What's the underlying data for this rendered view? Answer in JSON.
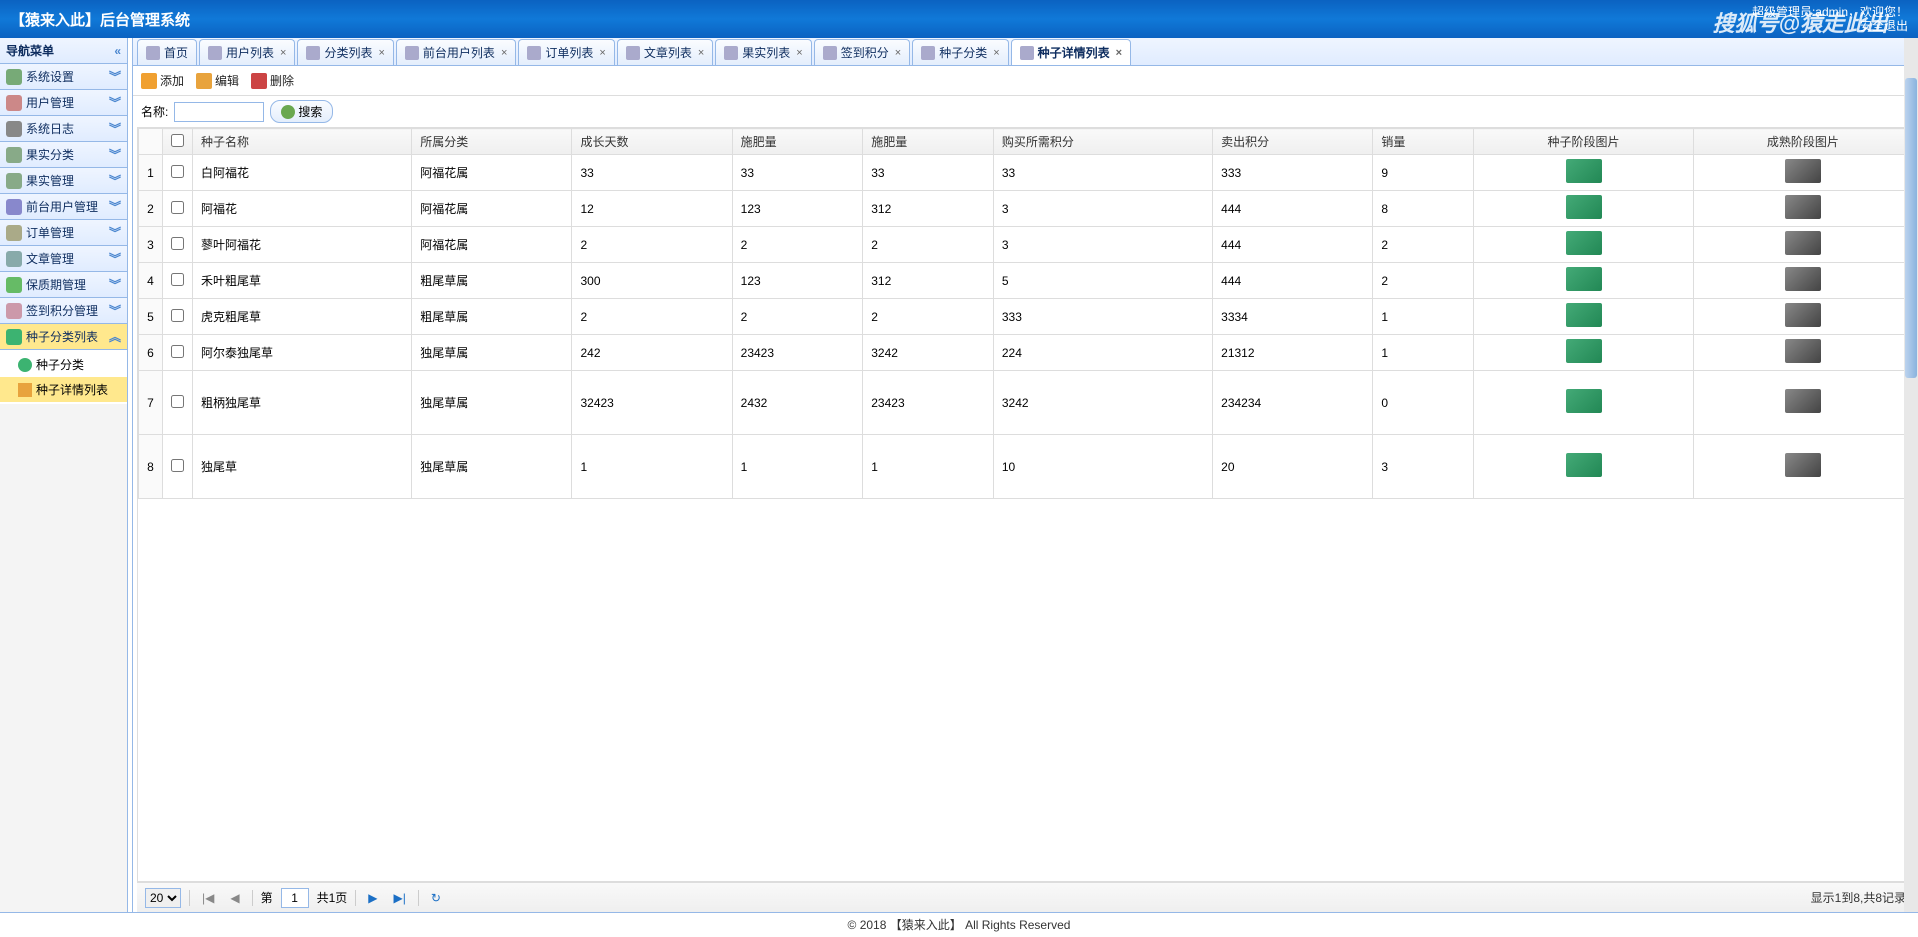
{
  "header": {
    "title": "【猿来入此】后台管理系统",
    "admin_label": "超级管理员:admin，欢迎您！",
    "logout": "安全退出"
  },
  "watermark": "搜狐号@猿走此出",
  "nav": {
    "title": "导航菜单",
    "collapse": "«",
    "items": [
      {
        "label": "系统设置",
        "icon": "#7a7"
      },
      {
        "label": "用户管理",
        "icon": "#c88"
      },
      {
        "label": "系统日志",
        "icon": "#888"
      },
      {
        "label": "果实分类",
        "icon": "#8a8"
      },
      {
        "label": "果实管理",
        "icon": "#8a8"
      },
      {
        "label": "前台用户管理",
        "icon": "#88c"
      },
      {
        "label": "订单管理",
        "icon": "#aa8"
      },
      {
        "label": "文章管理",
        "icon": "#8aa"
      },
      {
        "label": "保质期管理",
        "icon": "#6b6"
      },
      {
        "label": "签到积分管理",
        "icon": "#c9a"
      }
    ],
    "active": {
      "label": "种子分类列表"
    },
    "subs": [
      {
        "label": "种子分类"
      },
      {
        "label": "种子详情列表"
      }
    ]
  },
  "tabs": [
    {
      "label": "首页",
      "closable": false
    },
    {
      "label": "用户列表",
      "closable": true
    },
    {
      "label": "分类列表",
      "closable": true
    },
    {
      "label": "前台用户列表",
      "closable": true
    },
    {
      "label": "订单列表",
      "closable": true
    },
    {
      "label": "文章列表",
      "closable": true
    },
    {
      "label": "果实列表",
      "closable": true
    },
    {
      "label": "签到积分",
      "closable": true
    },
    {
      "label": "种子分类",
      "closable": true
    },
    {
      "label": "种子详情列表",
      "closable": true,
      "active": true
    }
  ],
  "toolbar": {
    "add": "添加",
    "edit": "编辑",
    "del": "删除"
  },
  "search": {
    "label": "名称:",
    "placeholder": "",
    "btn": "搜索"
  },
  "columns": [
    "种子名称",
    "所属分类",
    "成长天数",
    "施肥量",
    "施肥量",
    "购买所需积分",
    "卖出积分",
    "销量",
    "种子阶段图片",
    "成熟阶段图片"
  ],
  "rows": [
    {
      "n": 1,
      "c": [
        "白阿福花",
        "阿福花属",
        "33",
        "33",
        "33",
        "33",
        "333",
        "9"
      ]
    },
    {
      "n": 2,
      "c": [
        "阿福花",
        "阿福花属",
        "12",
        "123",
        "312",
        "3",
        "444",
        "8"
      ]
    },
    {
      "n": 3,
      "c": [
        "蓼叶阿福花",
        "阿福花属",
        "2",
        "2",
        "2",
        "3",
        "444",
        "2"
      ]
    },
    {
      "n": 4,
      "c": [
        "禾叶粗尾草",
        "粗尾草属",
        "300",
        "123",
        "312",
        "5",
        "444",
        "2"
      ]
    },
    {
      "n": 5,
      "c": [
        "虎克粗尾草",
        "粗尾草属",
        "2",
        "2",
        "2",
        "333",
        "3334",
        "1"
      ]
    },
    {
      "n": 6,
      "c": [
        "阿尔泰独尾草",
        "独尾草属",
        "242",
        "23423",
        "3242",
        "224",
        "21312",
        "1"
      ]
    },
    {
      "n": 7,
      "c": [
        "粗柄独尾草",
        "独尾草属",
        "32423",
        "2432",
        "23423",
        "3242",
        "234234",
        "0"
      ]
    },
    {
      "n": 8,
      "c": [
        "独尾草",
        "独尾草属",
        "1",
        "1",
        "1",
        "10",
        "20",
        "3"
      ]
    }
  ],
  "pager": {
    "size_options": [
      "20"
    ],
    "page_lbl": "第",
    "page_val": "1",
    "total_pages": "共1页",
    "info": "显示1到8,共8记录"
  },
  "footer": "© 2018 【猿来入此】 All Rights Reserved"
}
